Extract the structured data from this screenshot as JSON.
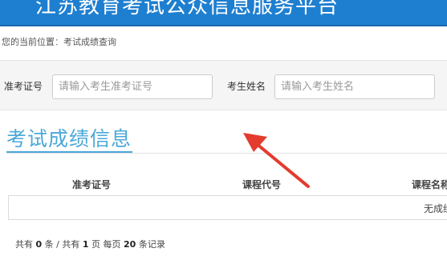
{
  "header": {
    "title": "江苏教育考试公众信息服务平台"
  },
  "breadcrumb": {
    "prefix": "您的当前位置",
    "separator": "：",
    "current": "考试成绩查询"
  },
  "search": {
    "ticket_label": "准考证号",
    "ticket_placeholder": "请输入考生准考证号",
    "name_label": "考生姓名",
    "name_placeholder": "请输入考生姓名"
  },
  "section": {
    "title": "考试成绩信息"
  },
  "table": {
    "columns": [
      "准考证号",
      "课程代号",
      "课程名称"
    ],
    "empty_text": "无成绩"
  },
  "pagination": {
    "p1": "共有 ",
    "records": "0",
    "p2": " 条 / 共有 ",
    "pages": "1",
    "p3": " 页 每页 ",
    "per_page": "20",
    "p4": " 条记录"
  },
  "colors": {
    "header_bg": "#1e7fd0",
    "accent": "#4aa8d8",
    "arrow": "#e33b2e"
  },
  "icons": {
    "annotation": "red-arrow-icon"
  }
}
